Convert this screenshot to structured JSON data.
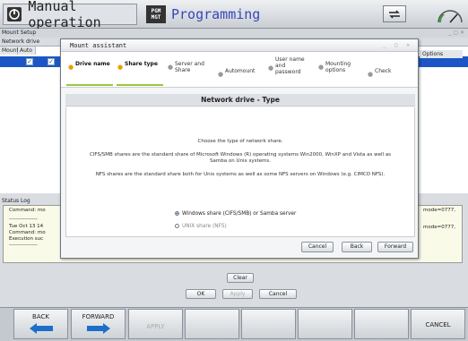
{
  "header": {
    "mode_manual": "Manual operation",
    "mode_programming": "Programming",
    "prog_icon_text": "PGM\nMGT"
  },
  "window": {
    "title": "Mount Setup",
    "network_drive_label": "Network drive",
    "columns": [
      "Mount",
      "Auto"
    ],
    "options_col": "Options"
  },
  "status": {
    "label": "Status Log",
    "lines": [
      "Command: mo",
      "----------------",
      "Tue Oct 13 14",
      "Command: mo",
      "Execution suc",
      "----------------"
    ],
    "right_lines": [
      "mode=0777,",
      "mode=0777,"
    ]
  },
  "buttons": {
    "clear": "Clear",
    "ok": "OK",
    "apply": "Apply",
    "cancel": "Cancel"
  },
  "softkeys": {
    "back": "BACK",
    "forward": "FORWARD",
    "apply": "APPLY",
    "cancel": "CANCEL"
  },
  "dialog": {
    "title": "Mount assistant",
    "steps": [
      {
        "label": "Drive name",
        "active": true
      },
      {
        "label": "Share type",
        "active": true
      },
      {
        "label": "Server and Share",
        "active": false
      },
      {
        "label": "Automount",
        "active": false
      },
      {
        "label": "User name and password",
        "active": false
      },
      {
        "label": "Mounting options",
        "active": false
      },
      {
        "label": "Check",
        "active": false
      }
    ],
    "content_title": "Network drive - Type",
    "intro": "Choose the type of network share.",
    "cifs_text_1": "CIFS/SMB shares are the standard share of Microsoft Windows (R) operating systems Win2000, WinXP and Vista as well as",
    "cifs_text_2": "Samba on Unix systems.",
    "nfs_text": "NFS shares are the standard share both for Unix systems as well as some NFS servers on Windows (e.g. CIMCO NFS).",
    "option_windows": "Windows share (CIFS/SMB) or Samba server",
    "option_unix": "UNIX share (NFS)",
    "btn_cancel": "Cancel",
    "btn_back": "Back",
    "btn_forward": "Forward"
  }
}
